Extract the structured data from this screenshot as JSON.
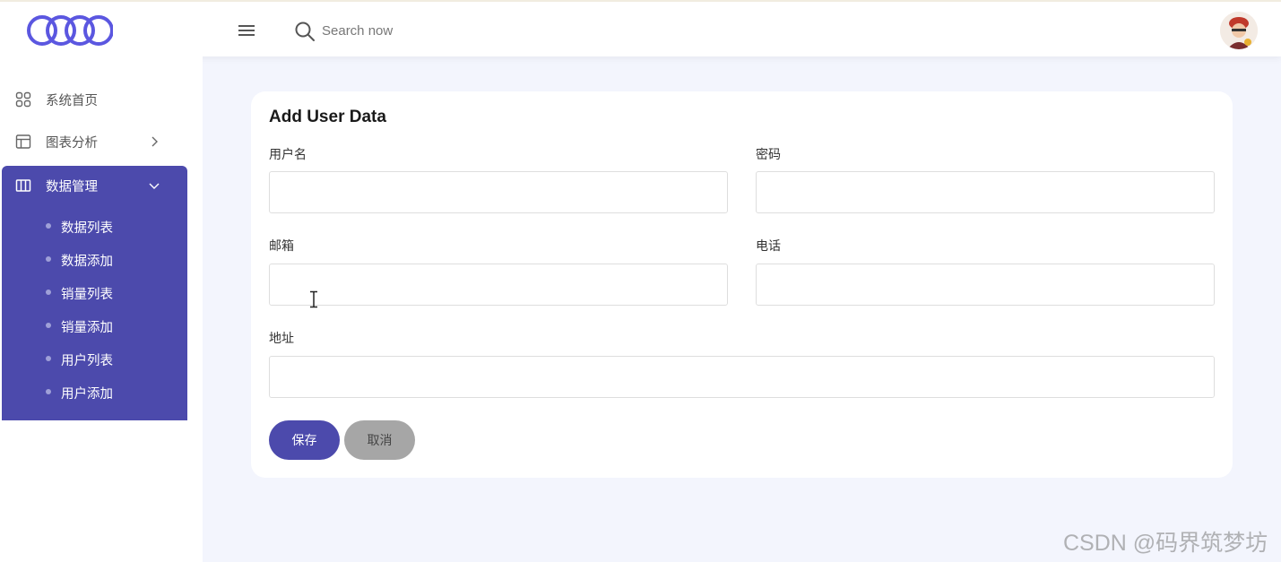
{
  "header": {
    "logo_icon": "rings-logo-icon",
    "menu_icon": "hamburger-icon",
    "search_icon": "search-icon",
    "search_placeholder": "Search now",
    "avatar_icon": "user-avatar"
  },
  "sidebar": {
    "items": [
      {
        "label": "系统首页",
        "icon": "grid-icon"
      },
      {
        "label": "图表分析",
        "icon": "table-layout-icon"
      },
      {
        "label": "数据管理",
        "icon": "columns-icon"
      }
    ],
    "submenu": [
      {
        "label": "数据列表"
      },
      {
        "label": "数据添加"
      },
      {
        "label": "销量列表"
      },
      {
        "label": "销量添加"
      },
      {
        "label": "用户列表"
      },
      {
        "label": "用户添加"
      }
    ]
  },
  "form": {
    "title": "Add User Data",
    "fields": {
      "username": {
        "label": "用户名",
        "value": ""
      },
      "password": {
        "label": "密码",
        "value": ""
      },
      "email": {
        "label": "邮箱",
        "value": ""
      },
      "phone": {
        "label": "电话",
        "value": ""
      },
      "address": {
        "label": "地址",
        "value": ""
      }
    },
    "save_label": "保存",
    "cancel_label": "取消"
  },
  "watermark": "CSDN @码界筑梦坊",
  "colors": {
    "accent": "#4c4aac",
    "logo": "#5b57e0",
    "background": "#f3f5fd",
    "cancel_button": "#a6a6a6"
  }
}
